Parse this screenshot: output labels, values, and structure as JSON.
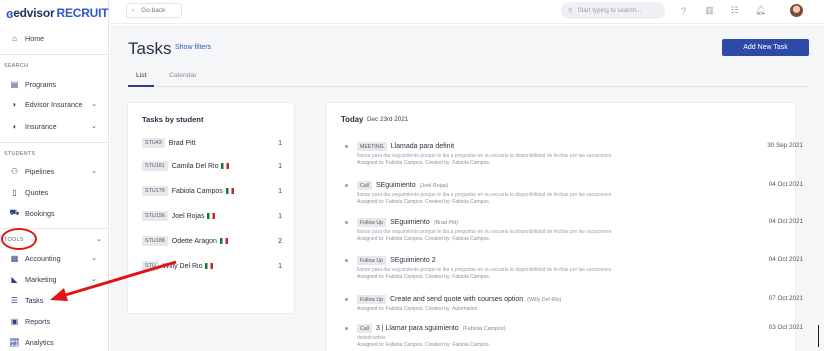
{
  "brand": {
    "name": "edvisor",
    "suffix": "RECRUIT"
  },
  "sidebar": {
    "home": "Home",
    "sections": {
      "search": "SEARCH",
      "students": "STUDENTS",
      "tools": "TOOLS"
    },
    "items": {
      "programs": "Programs",
      "edvisor_insurance": "Edvisor Insurance",
      "insurance": "Insurance",
      "pipelines": "Pipelines",
      "quotes": "Quotes",
      "bookings": "Bookings",
      "accounting": "Accounting",
      "marketing": "Marketing",
      "tasks": "Tasks",
      "reports": "Reports",
      "analytics": "Analytics"
    }
  },
  "topbar": {
    "back_label": "Go back",
    "search_placeholder": "Start typing to search..."
  },
  "page": {
    "title": "Tasks",
    "show_filters": "Show filters",
    "add_button": "Add New Task"
  },
  "tabs": {
    "list": "List",
    "calendar": "Calendar"
  },
  "students_card": {
    "title": "Tasks by student",
    "rows": [
      {
        "code": "STU43",
        "name": "Brad Pitt",
        "flag": false,
        "count": "1"
      },
      {
        "code": "STU181",
        "name": "Camila Del Rio",
        "flag": true,
        "count": "1"
      },
      {
        "code": "STU179",
        "name": "Fabiola Campos",
        "flag": true,
        "count": "1"
      },
      {
        "code": "STU156",
        "name": "Joel Rojas",
        "flag": true,
        "count": "1"
      },
      {
        "code": "STU188",
        "name": "Odette Aragon",
        "flag": true,
        "count": "2"
      },
      {
        "code": "STU",
        "name": "Willy Del Rio",
        "flag": true,
        "count": "1"
      }
    ]
  },
  "today_card": {
    "title": "Today",
    "date": "Dec 23rd 2021",
    "tasks": [
      {
        "type": "MEETING",
        "title": "Llamada para definit",
        "who": "",
        "desc": "llamar para dar seguimiento porque le iba a preguntar en su escuela la disponibilidad de fechas por las vacaciones",
        "assigned": "Assigned to: Fabiola Campos. Created by: Fabiola Campos.",
        "date": "30 Sep 2021"
      },
      {
        "type": "Call",
        "title": "SEguimiento",
        "who": "(Joel Rojas)",
        "desc": "llamar para dar seguimiento porque le iba a preguntar en su escuela la disponibilidad de fechas por las vacaciones",
        "assigned": "Assigned to: Fabiola Campos. Created by: Fabiola Campos.",
        "date": "04 Oct 2021"
      },
      {
        "type": "Follow Up",
        "title": "SEguimiento",
        "who": "(Brad Pitt)",
        "desc": "llamar para dar seguimiento porque le iba a preguntar en su escuela la disponibilidad de fechas por las vacaciones",
        "assigned": "Assigned to: Fabiola Campos. Created by: Fabiola Campos.",
        "date": "04 Oct 2021"
      },
      {
        "type": "Follow Up",
        "title": "SEguimiento 2",
        "who": "",
        "desc": "llamar para dar seguimiento porque le iba a preguntar en su escuela la disponibilidad de fechas por las vacaciones",
        "assigned": "Assigned to: Fabiola Campos. Created by: Fabiola Campos.",
        "date": "04 Oct 2021"
      },
      {
        "type": "Follow Up",
        "title": "Create and send quote with courses option",
        "who": "(Willy Del Rio)",
        "desc": "",
        "assigned": "Assigned to: Fabiola Campos. Created by: Automation.",
        "date": "07 Oct 2021"
      },
      {
        "type": "Call",
        "title": "3 | Llamar para sguimiento",
        "who": "(Fabiola Campos)",
        "desc": "dsdsdcwdwo",
        "assigned": "Assigned to: Fabiola Campos. Created by: Fabiola Campos.",
        "date": "03 Oct 2021"
      }
    ]
  },
  "colors": {
    "accent": "#2e4aa8",
    "annotation": "#e01414"
  }
}
